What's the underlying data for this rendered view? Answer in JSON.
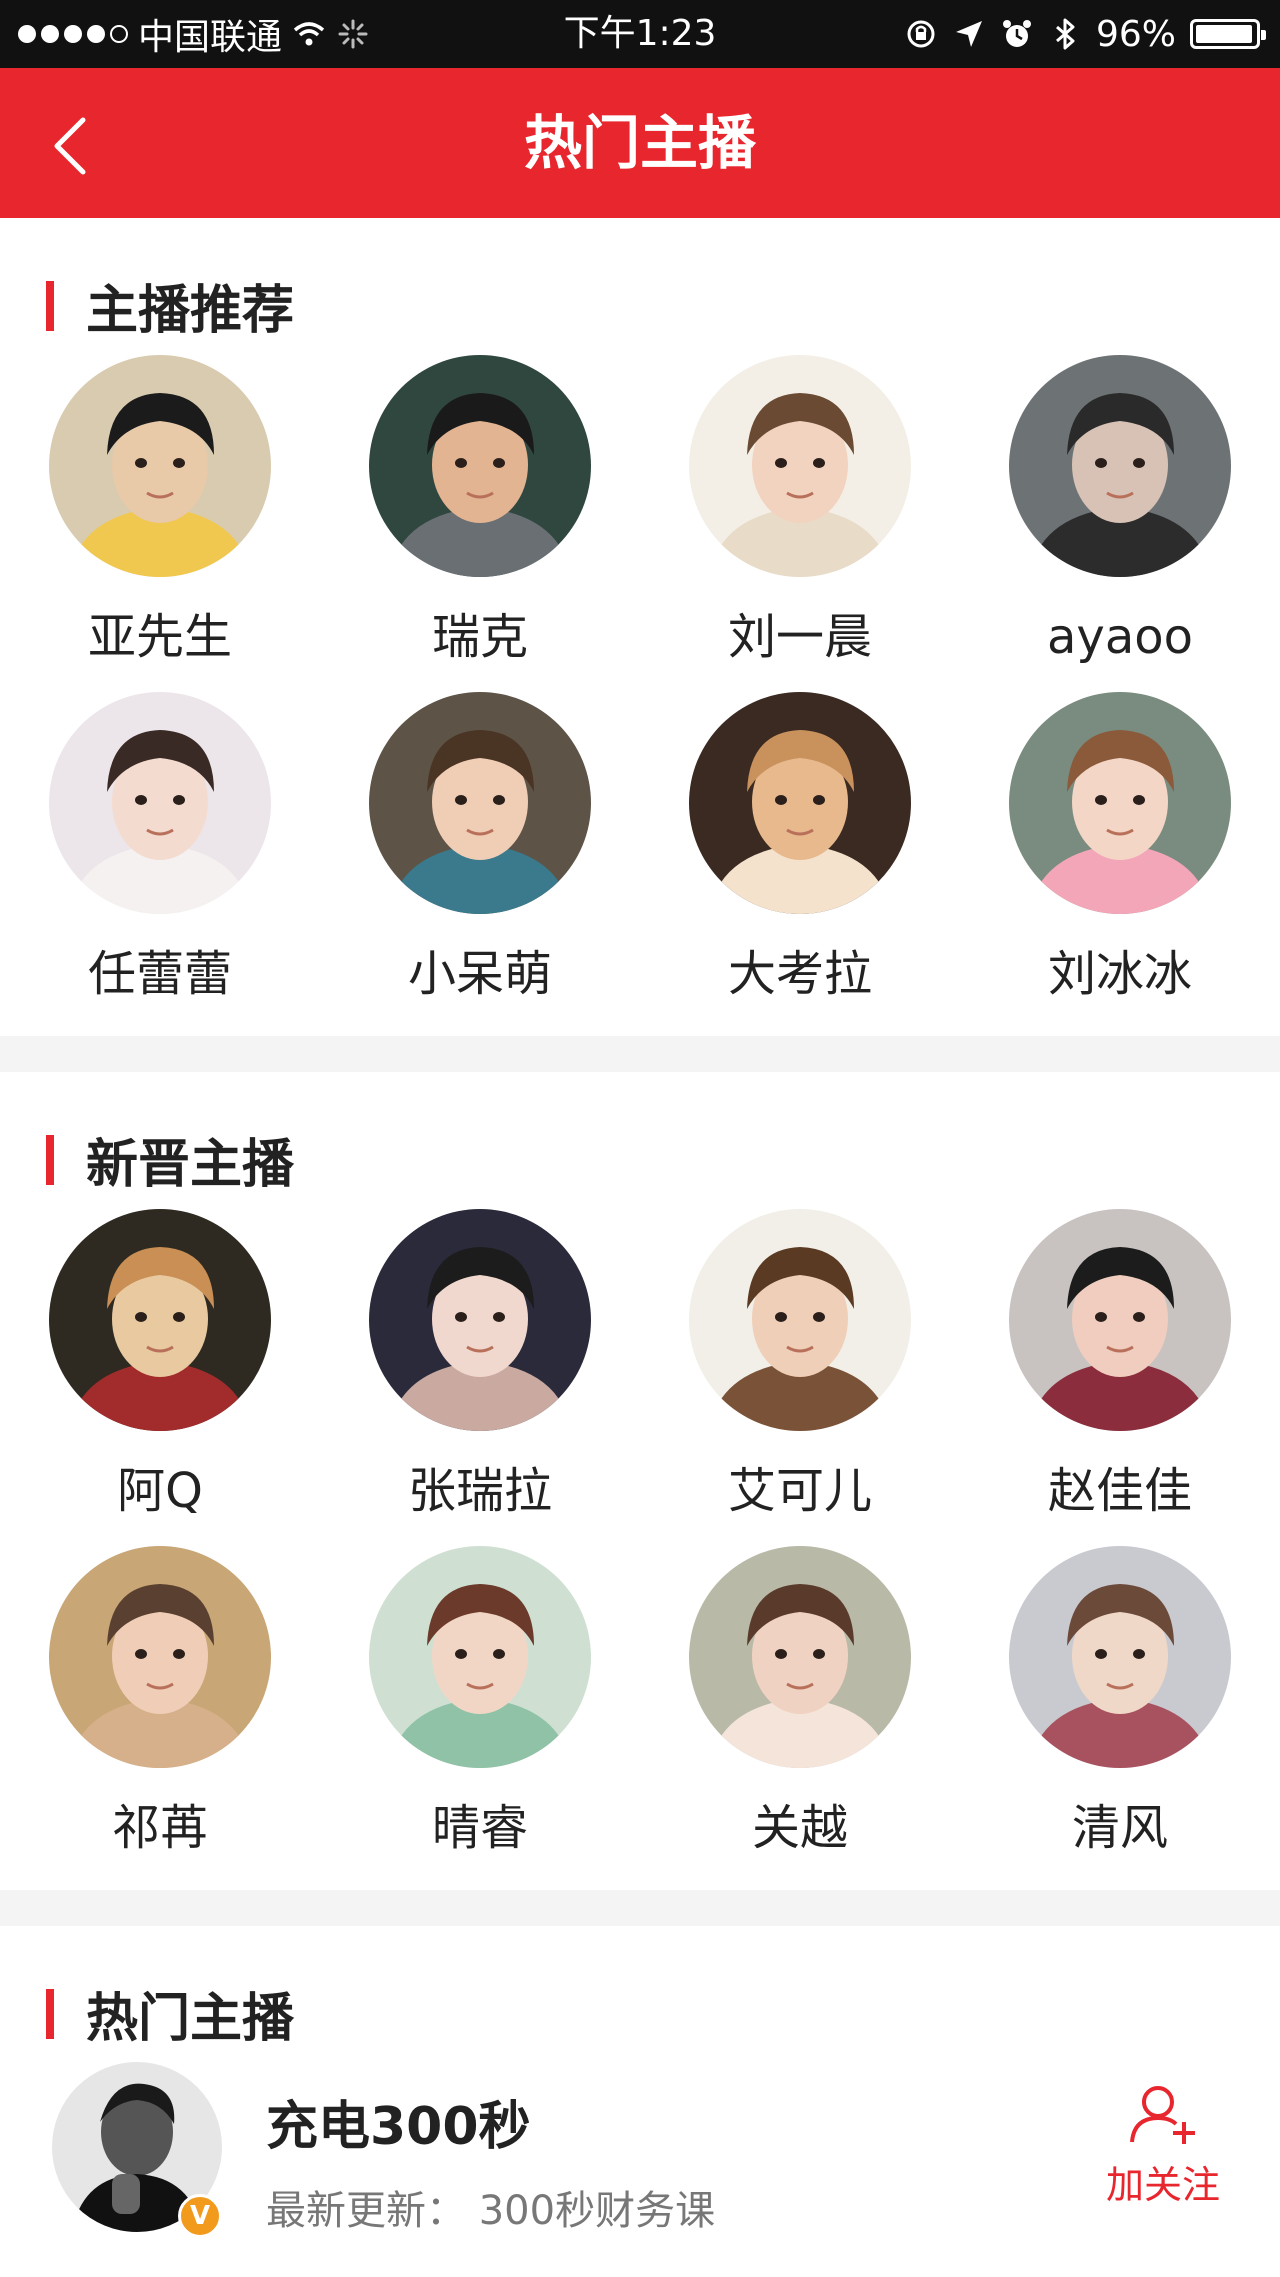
{
  "status_bar": {
    "carrier": "中国联通",
    "time": "下午1:23",
    "battery": "96%",
    "battery_level": 0.96,
    "icons": [
      "signal-dots-icon",
      "wifi-icon",
      "loading-icon",
      "rotation-lock-icon",
      "location-icon",
      "alarm-icon",
      "bluetooth-icon",
      "battery-icon"
    ]
  },
  "nav": {
    "title": "热门主播",
    "back_icon": "chevron-left-icon"
  },
  "recommended": {
    "title": "主播推荐",
    "items": [
      {
        "name": "亚先生"
      },
      {
        "name": "瑞克"
      },
      {
        "name": "刘一晨"
      },
      {
        "name": "ayaoo"
      },
      {
        "name": "任蕾蕾"
      },
      {
        "name": "小呆萌"
      },
      {
        "name": "大考拉"
      },
      {
        "name": "刘冰冰"
      }
    ]
  },
  "new_anchors": {
    "title": "新晋主播",
    "items": [
      {
        "name": "阿Q"
      },
      {
        "name": "张瑞拉"
      },
      {
        "name": "艾可儿"
      },
      {
        "name": "赵佳佳"
      },
      {
        "name": "祁苒"
      },
      {
        "name": "晴睿"
      },
      {
        "name": "关越"
      },
      {
        "name": "清风"
      }
    ]
  },
  "hot_anchors": {
    "title": "热门主播",
    "items": [
      {
        "name": "充电300秒",
        "update_label": "最新更新：",
        "update_value": "300秒财务课",
        "badge": "V",
        "follow_label": "加关注"
      }
    ]
  },
  "colors": {
    "accent": "#e8262d",
    "badge": "#f29a1c"
  }
}
